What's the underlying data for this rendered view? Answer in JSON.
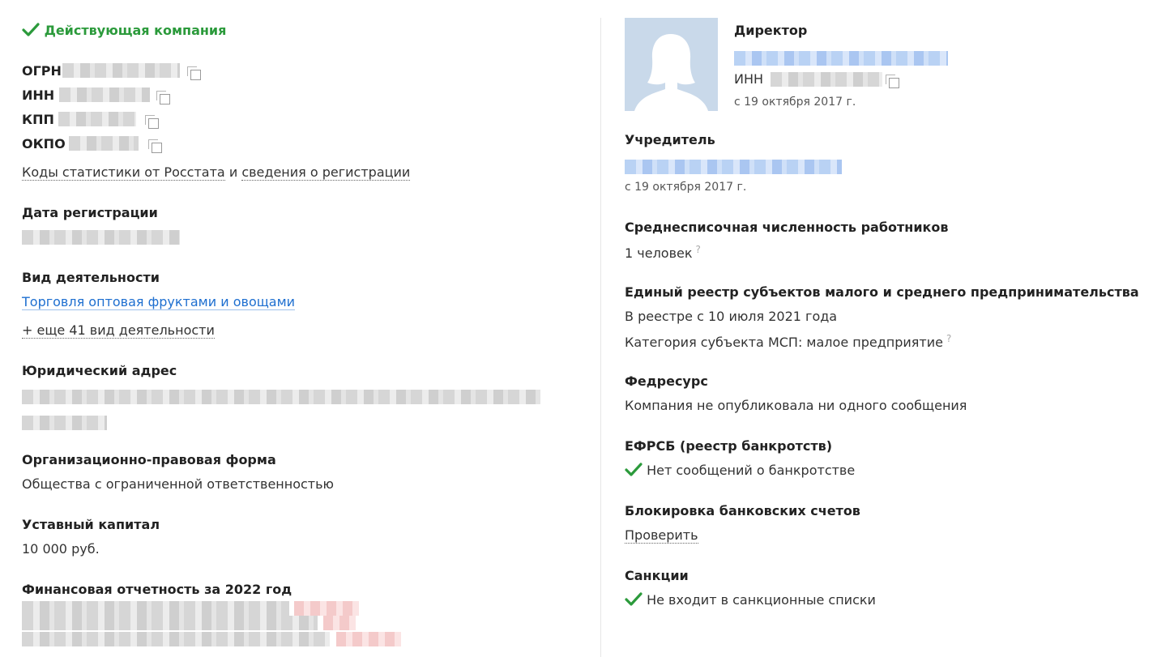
{
  "left": {
    "status": "Действующая компания",
    "ids": [
      {
        "label": "ОГРН"
      },
      {
        "label": "ИНН"
      },
      {
        "label": "КПП"
      },
      {
        "label": "ОКПО"
      }
    ],
    "stats_link": "Коды статистики от Росстата",
    "stats_and": "и",
    "reg_link": "сведения о регистрации",
    "reg_date_label": "Дата регистрации",
    "activity_label": "Вид деятельности",
    "activity_main": "Торговля оптовая фруктами и овощами",
    "activity_more": "+ еще 41 вид деятельности",
    "address_label": "Юридический адрес",
    "legal_form_label": "Организационно-правовая форма",
    "legal_form_value": "Общества с ограниченной ответственностью",
    "capital_label": "Уставный капитал",
    "capital_value": "10 000 руб.",
    "finance_label": "Финансовая отчетность за 2022 год"
  },
  "right": {
    "director_label": "Директор",
    "director_inn_label": "ИНН",
    "director_since": "с 19 октября 2017 г.",
    "founder_label": "Учредитель",
    "founder_since": "с 19 октября 2017 г.",
    "employees_label": "Среднесписочная численность работников",
    "employees_value": "1 человек",
    "msp_label": "Единый реестр субъектов малого и среднего предпринимательства",
    "msp_since": "В реестре с 10 июля 2021 года",
    "msp_category": "Категория субъекта МСП: малое предприятие",
    "fedresurs_label": "Федресурс",
    "fedresurs_value": "Компания не опубликовала ни одного сообщения",
    "efrsb_label": "ЕФРСБ (реестр банкротств)",
    "efrsb_value": "Нет сообщений о банкротстве",
    "block_label": "Блокировка банковских счетов",
    "block_link": "Проверить",
    "sanctions_label": "Санкции",
    "sanctions_value": "Не входит в санкционные списки",
    "question_mark": "?"
  },
  "colors": {
    "accent_green": "#2b9a3b",
    "link_blue": "#1e6fd0"
  }
}
